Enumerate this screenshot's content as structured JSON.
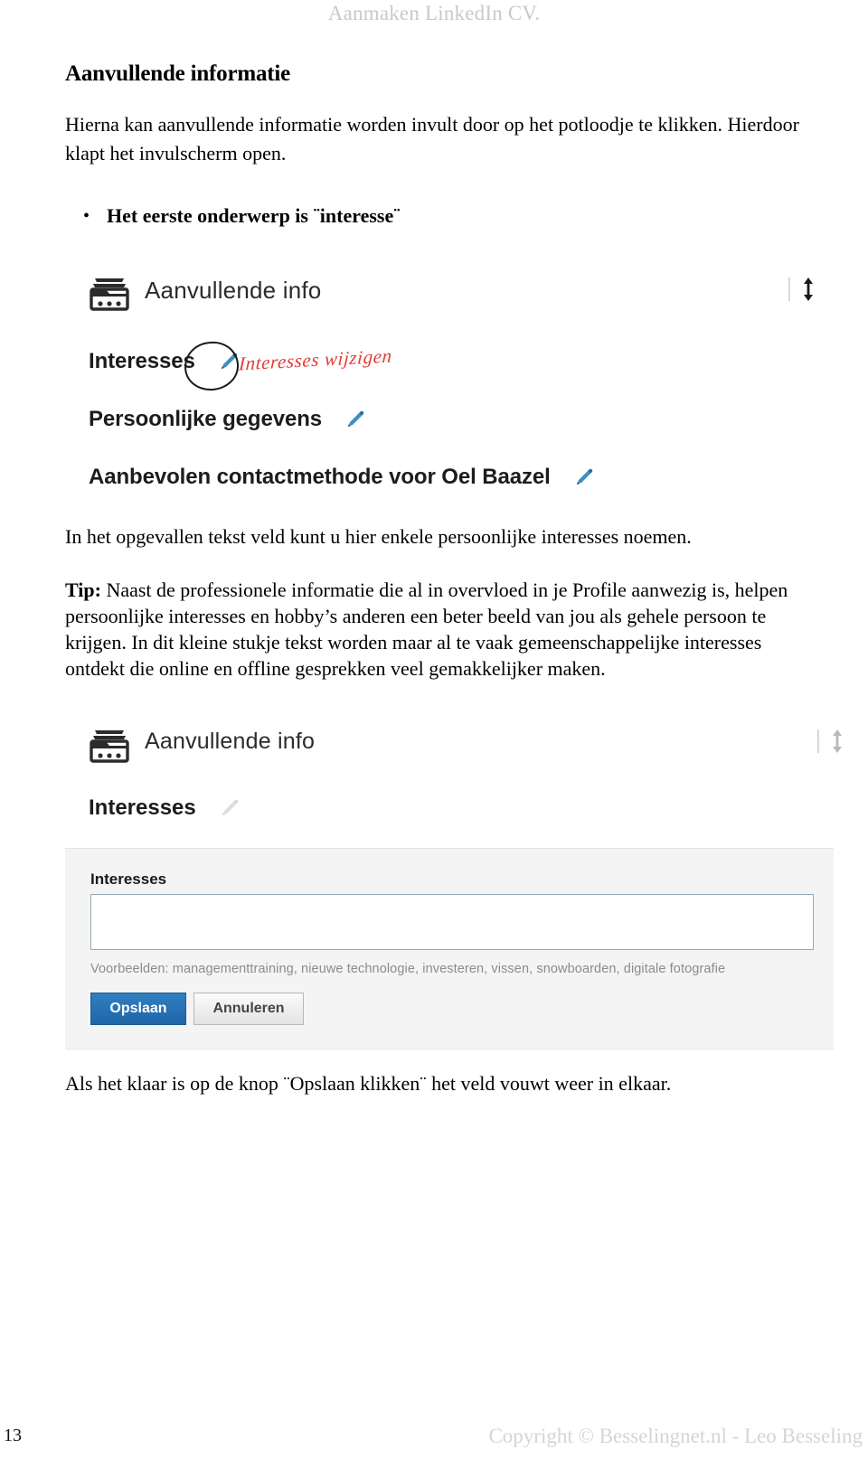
{
  "running_head": "Aanmaken LinkedIn CV.",
  "section": {
    "title": "Aanvullende informatie",
    "intro": "Hierna kan aanvullende informatie worden invult door op het potloodje te klikken. Hierdoor klapt het invulscherm open.",
    "bullet_marker": "•",
    "bullet": "Het eerste onderwerp is ¨interesse¨"
  },
  "screenshot_collapsed": {
    "header_label": "Aanvullende info",
    "header_icon": "card-box-icon",
    "collapse_icon": "expand-collapse-arrow-icon",
    "rows": [
      {
        "label": "Interesses",
        "edit_icon": "pencil-icon"
      },
      {
        "label": "Persoonlijke gegevens",
        "edit_icon": "pencil-icon"
      },
      {
        "label": "Aanbevolen contactmethode voor Oel Baazel",
        "edit_icon": "pencil-icon"
      }
    ],
    "annotation": {
      "text": "Interesses wijzigen",
      "color": "#e03b34",
      "shape": "hand-drawn-circle"
    }
  },
  "mid_text": {
    "line1": "In het opgevallen tekst veld kunt u hier enkele persoonlijke interesses noemen.",
    "tip_label": "Tip:",
    "tip_body": " Naast de professionele informatie die al in overvloed in je Profile aanwezig is, helpen persoonlijke interesses en hobby’s anderen een beter beeld van jou als gehele persoon te krijgen. In dit kleine stukje tekst worden maar al te vaak gemeenschappelijke interesses ontdekt die online en offline gesprekken veel gemakkelijker maken."
  },
  "screenshot_expanded": {
    "header_label": "Aanvullende info",
    "header_icon": "card-box-icon",
    "collapse_icon": "expand-collapse-arrow-icon",
    "section_row_label": "Interesses",
    "section_row_icon": "pencil-icon",
    "form": {
      "field_label": "Interesses",
      "field_value": "",
      "field_placeholder": "",
      "hint": "Voorbeelden: managementtraining, nieuwe technologie, investeren, vissen, snowboarden, digitale fotografie",
      "save_label": "Opslaan",
      "cancel_label": "Annuleren",
      "save_color": "#226caf"
    }
  },
  "closing_text": "Als het klaar is op de knop ¨Opslaan klikken¨ het veld vouwt weer in elkaar.",
  "footer": {
    "page_number": "13",
    "copyright": "Copyright © Besselingnet.nl -  Leo Besseling"
  }
}
